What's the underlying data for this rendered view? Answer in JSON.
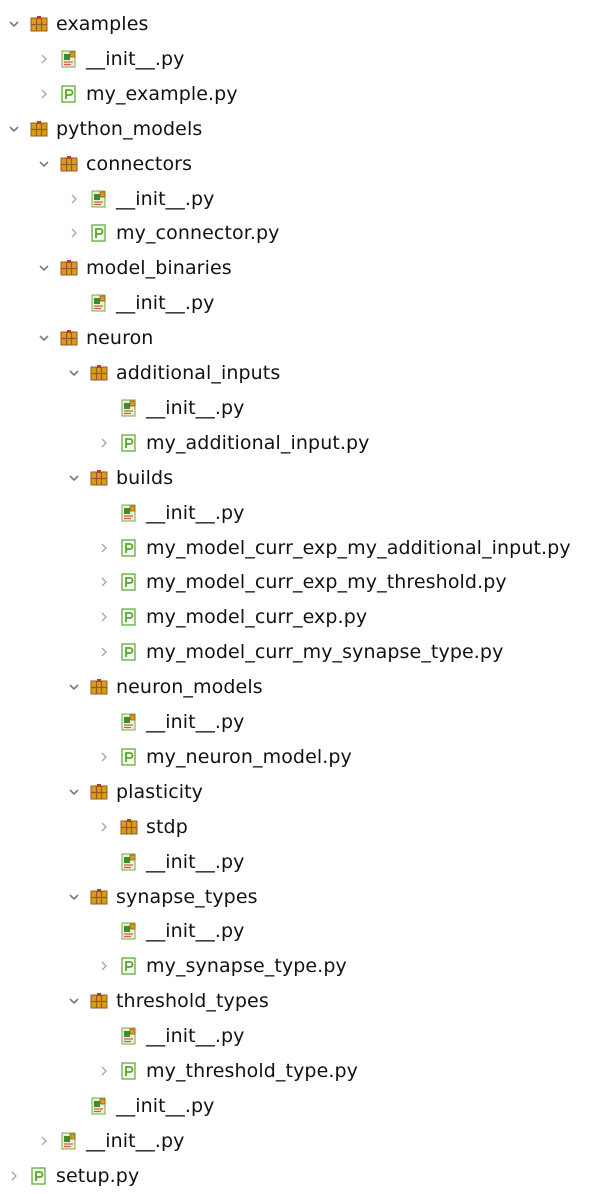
{
  "items": [
    {
      "label": "examples",
      "type": "package",
      "twisty": "expanded",
      "depth": 0
    },
    {
      "label": "__init__.py",
      "type": "init",
      "twisty": "collapsed",
      "depth": 1
    },
    {
      "label": "my_example.py",
      "type": "module",
      "twisty": "collapsed",
      "depth": 1
    },
    {
      "label": "python_models",
      "type": "package",
      "twisty": "expanded",
      "depth": 0
    },
    {
      "label": "connectors",
      "type": "package",
      "twisty": "expanded",
      "depth": 1
    },
    {
      "label": "__init__.py",
      "type": "init",
      "twisty": "collapsed",
      "depth": 2
    },
    {
      "label": "my_connector.py",
      "type": "module",
      "twisty": "collapsed",
      "depth": 2
    },
    {
      "label": "model_binaries",
      "type": "package",
      "twisty": "expanded",
      "depth": 1
    },
    {
      "label": "__init__.py",
      "type": "init",
      "twisty": "none",
      "depth": 2
    },
    {
      "label": "neuron",
      "type": "package",
      "twisty": "expanded",
      "depth": 1
    },
    {
      "label": "additional_inputs",
      "type": "package",
      "twisty": "expanded",
      "depth": 2
    },
    {
      "label": "__init__.py",
      "type": "init",
      "twisty": "none",
      "depth": 3
    },
    {
      "label": "my_additional_input.py",
      "type": "module",
      "twisty": "collapsed",
      "depth": 3
    },
    {
      "label": "builds",
      "type": "package",
      "twisty": "expanded",
      "depth": 2
    },
    {
      "label": "__init__.py",
      "type": "init",
      "twisty": "none",
      "depth": 3
    },
    {
      "label": "my_model_curr_exp_my_additional_input.py",
      "type": "module",
      "twisty": "collapsed",
      "depth": 3
    },
    {
      "label": "my_model_curr_exp_my_threshold.py",
      "type": "module",
      "twisty": "collapsed",
      "depth": 3
    },
    {
      "label": "my_model_curr_exp.py",
      "type": "module",
      "twisty": "collapsed",
      "depth": 3
    },
    {
      "label": "my_model_curr_my_synapse_type.py",
      "type": "module",
      "twisty": "collapsed",
      "depth": 3
    },
    {
      "label": "neuron_models",
      "type": "package",
      "twisty": "expanded",
      "depth": 2
    },
    {
      "label": "__init__.py",
      "type": "init",
      "twisty": "none",
      "depth": 3
    },
    {
      "label": "my_neuron_model.py",
      "type": "module",
      "twisty": "collapsed",
      "depth": 3
    },
    {
      "label": "plasticity",
      "type": "package",
      "twisty": "expanded",
      "depth": 2
    },
    {
      "label": "stdp",
      "type": "package",
      "twisty": "collapsed",
      "depth": 3
    },
    {
      "label": "__init__.py",
      "type": "init",
      "twisty": "none",
      "depth": 3
    },
    {
      "label": "synapse_types",
      "type": "package",
      "twisty": "expanded",
      "depth": 2
    },
    {
      "label": "__init__.py",
      "type": "init",
      "twisty": "none",
      "depth": 3
    },
    {
      "label": "my_synapse_type.py",
      "type": "module",
      "twisty": "collapsed",
      "depth": 3
    },
    {
      "label": "threshold_types",
      "type": "package",
      "twisty": "expanded",
      "depth": 2
    },
    {
      "label": "__init__.py",
      "type": "init",
      "twisty": "none",
      "depth": 3
    },
    {
      "label": "my_threshold_type.py",
      "type": "module",
      "twisty": "collapsed",
      "depth": 3
    },
    {
      "label": "__init__.py",
      "type": "init",
      "twisty": "none",
      "depth": 2
    },
    {
      "label": "__init__.py",
      "type": "init",
      "twisty": "collapsed",
      "depth": 1
    },
    {
      "label": "setup.py",
      "type": "module",
      "twisty": "collapsed",
      "depth": 0
    }
  ],
  "colors": {
    "package": "#d4a017",
    "package_dark": "#a0522d",
    "init_page": "#e8f3d0",
    "init_green": "#3c8d2f",
    "init_accent": "#d9534f",
    "module_green": "#55a630",
    "twisty": "#7a7a7a"
  }
}
